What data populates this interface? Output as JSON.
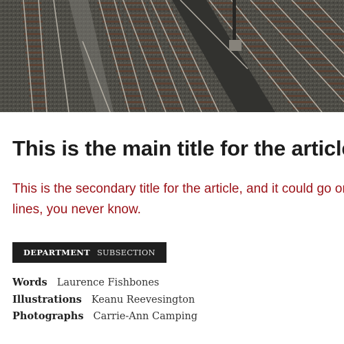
{
  "hero": {
    "image_description": "railway tracks from above",
    "colors": {
      "ballast": "#5b5a56",
      "rail": "#c9c3b8",
      "sleeper": "#6b4a38",
      "platform": "#3e3d3a"
    }
  },
  "article": {
    "main_title": "This is the main title for the article",
    "secondary_title": "This is the secondary title for the article, and it could go on for lines, you never know."
  },
  "section_tag": {
    "department": "DEPARTMENT",
    "subsection": "SUBSECTION"
  },
  "credits": [
    {
      "role": "Words",
      "name": "Laurence Fishbones"
    },
    {
      "role": "Illustrations",
      "name": "Keanu Reevesington"
    },
    {
      "role": "Photographs",
      "name": "Carrie-Ann Camping"
    }
  ],
  "colors": {
    "title": "#1c1c1c",
    "accent_red": "#9b1218",
    "tag_background": "#1f1f1f"
  }
}
